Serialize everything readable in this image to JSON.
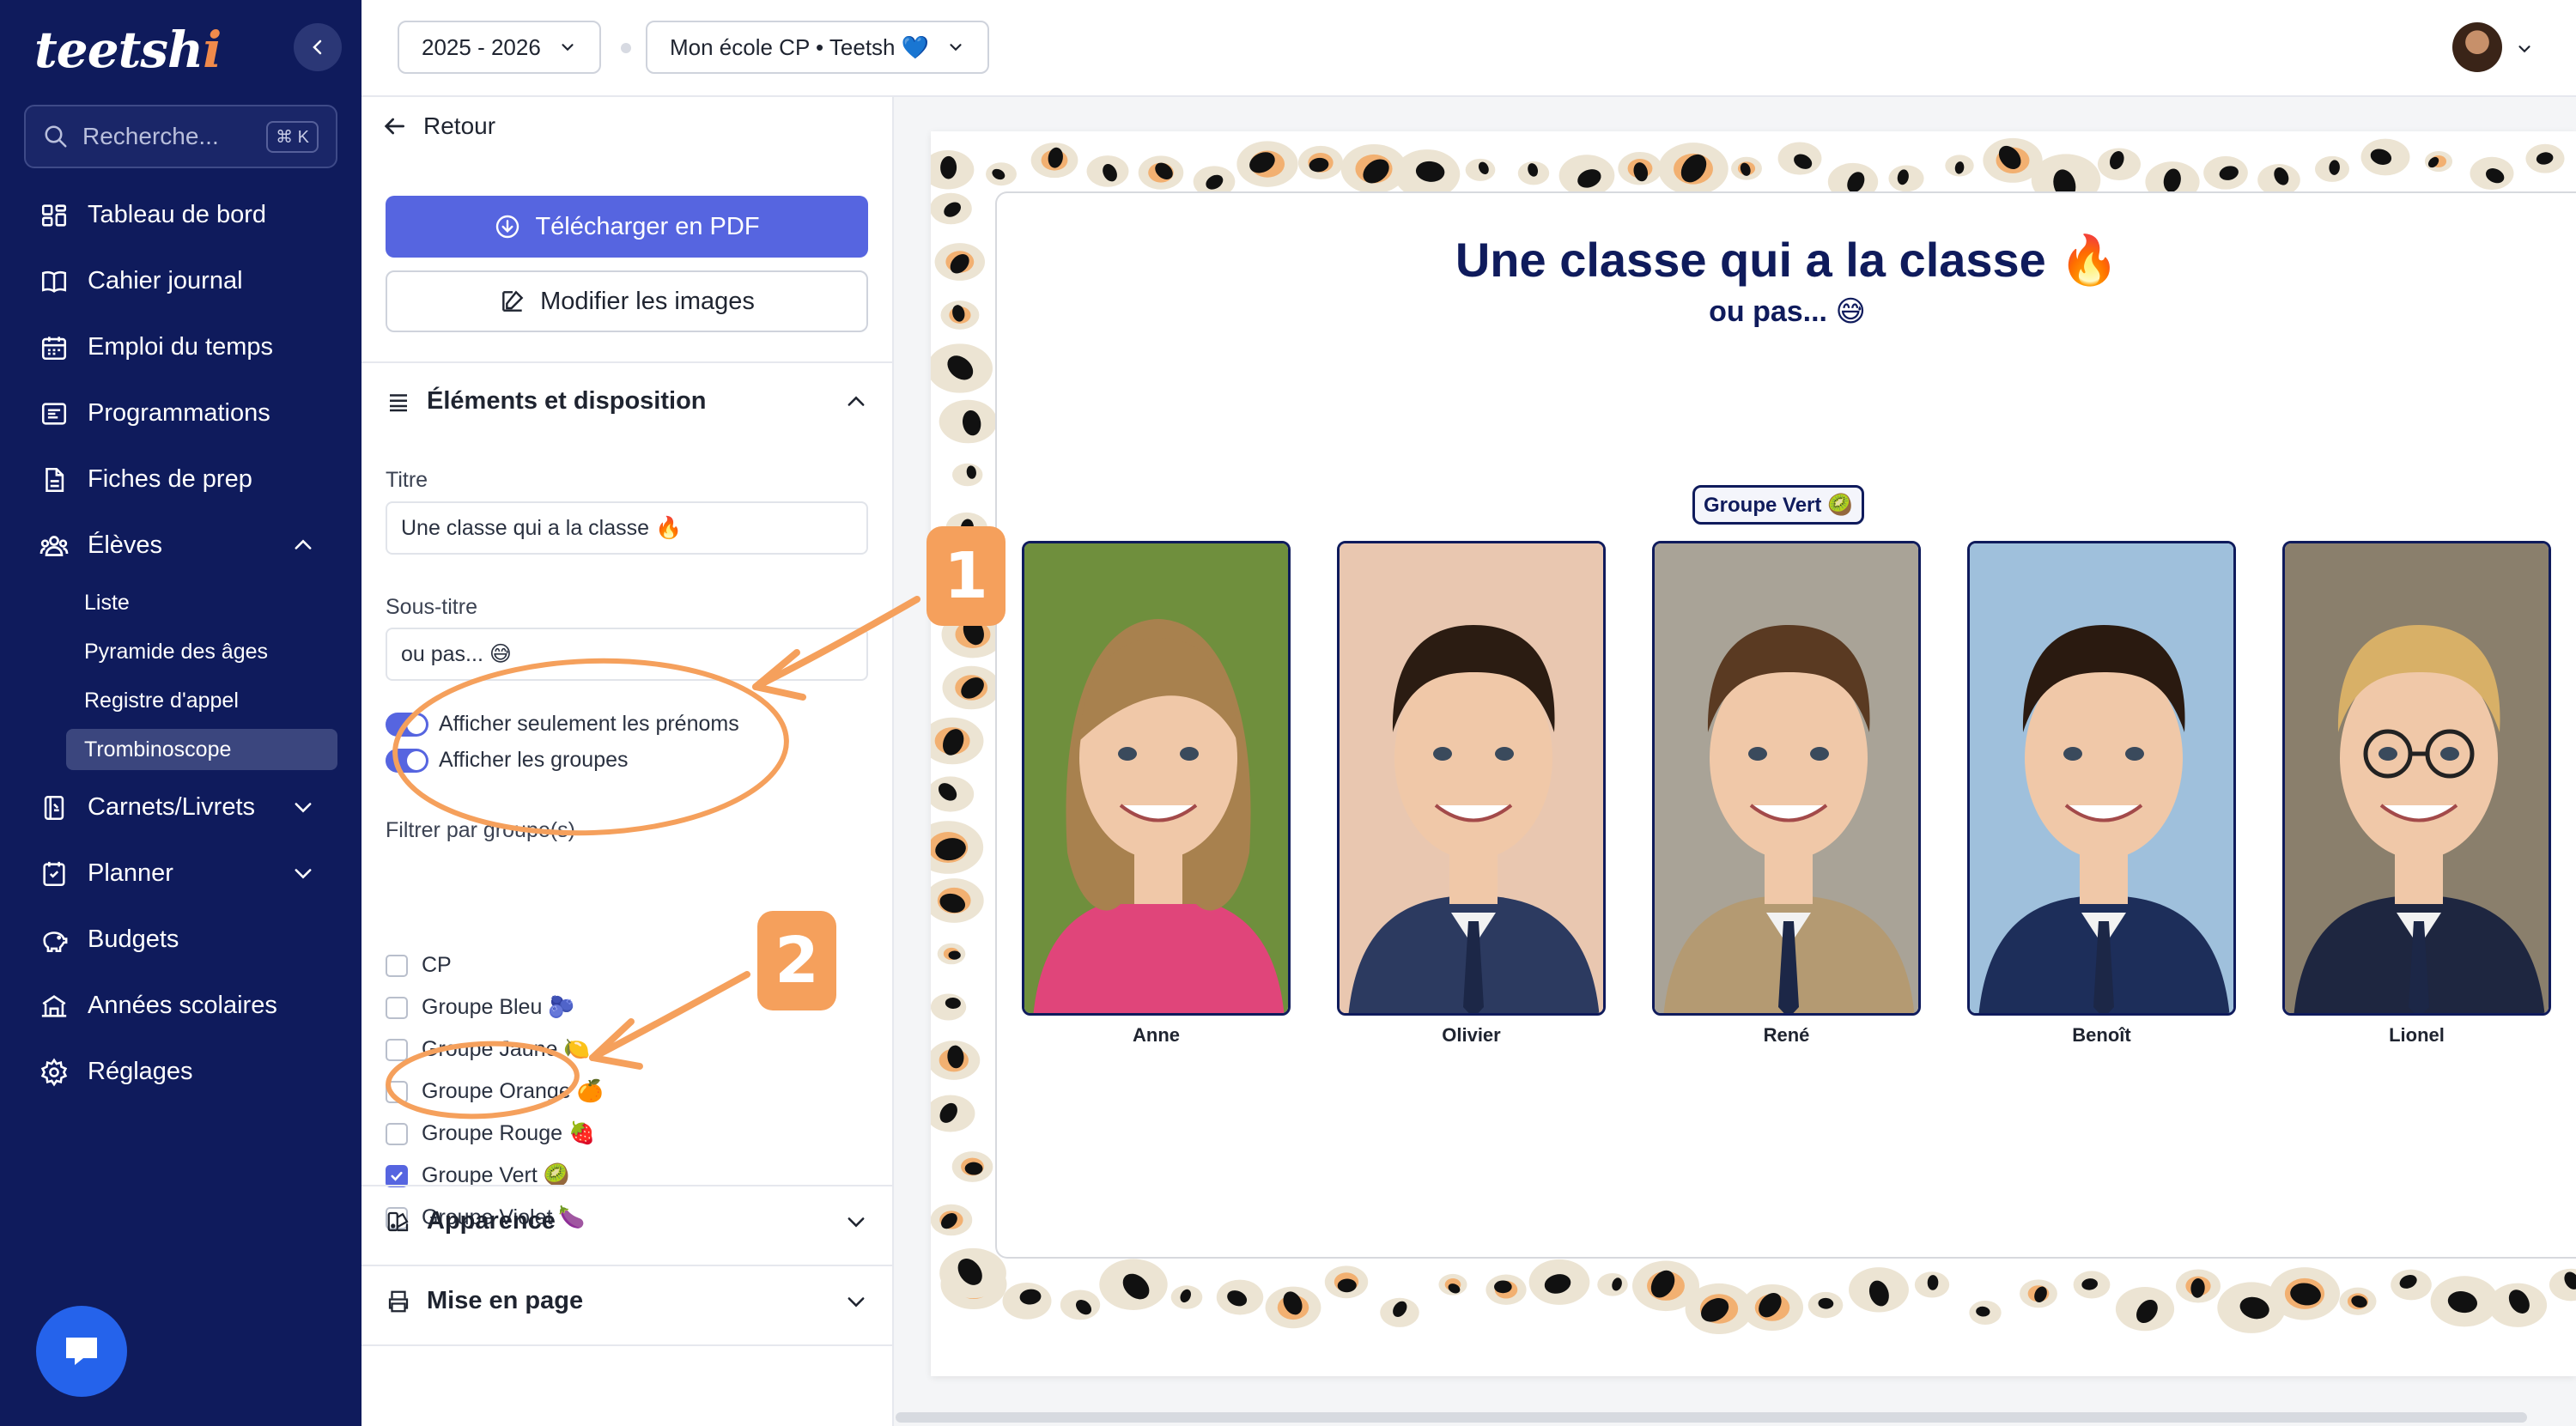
{
  "app": {
    "logo": "teetsh",
    "logo_suffix": "i"
  },
  "sidebar": {
    "search_placeholder": "Recherche...",
    "search_shortcut": "⌘ K",
    "items": [
      {
        "label": "Tableau de bord",
        "icon": "dashboard-icon"
      },
      {
        "label": "Cahier journal",
        "icon": "book-icon"
      },
      {
        "label": "Emploi du temps",
        "icon": "calendar-icon"
      },
      {
        "label": "Programmations",
        "icon": "list-icon"
      },
      {
        "label": "Fiches de prep",
        "icon": "file-icon"
      },
      {
        "label": "Élèves",
        "icon": "users-icon",
        "expanded": true
      },
      {
        "label": "Carnets/Livrets",
        "icon": "notebook-icon"
      },
      {
        "label": "Planner",
        "icon": "planner-icon"
      },
      {
        "label": "Budgets",
        "icon": "piggy-bank-icon"
      },
      {
        "label": "Années scolaires",
        "icon": "school-icon"
      },
      {
        "label": "Réglages",
        "icon": "gear-icon"
      }
    ],
    "eleves_sub": [
      "Liste",
      "Pyramide des âges",
      "Registre d'appel",
      "Trombinoscope"
    ],
    "active_sub": "Trombinoscope"
  },
  "topbar": {
    "year_select": "2025 - 2026",
    "school_select": "Mon école CP • Teetsh 💙"
  },
  "panel": {
    "back_label": "Retour",
    "download_pdf": "Télécharger en PDF",
    "edit_images": "Modifier les images",
    "section_elements": "Éléments et disposition",
    "title_label": "Titre",
    "title_value": "Une classe qui a la classe 🔥",
    "subtitle_label": "Sous-titre",
    "subtitle_value": "ou pas... 😅",
    "toggle_firstnames": "Afficher seulement les prénoms",
    "toggle_groups": "Afficher les groupes",
    "filter_label": "Filtrer par groupe(s)",
    "groups": [
      {
        "label": "CP",
        "checked": false
      },
      {
        "label": "Groupe Bleu 🫐",
        "checked": false
      },
      {
        "label": "Groupe Jaune 🍋",
        "checked": false
      },
      {
        "label": "Groupe Orange 🍊",
        "checked": false
      },
      {
        "label": "Groupe Rouge 🍓",
        "checked": false
      },
      {
        "label": "Groupe Vert 🥝",
        "checked": true
      },
      {
        "label": "Groupe Violet 🍆",
        "checked": false
      }
    ],
    "section_appearance": "Apparence",
    "section_layout": "Mise en page"
  },
  "annotations": {
    "badge_1": "1",
    "badge_2": "2",
    "color": "#f5a05c"
  },
  "preview": {
    "title": "Une classe qui a la classe 🔥",
    "subtitle": "ou pas... 😅",
    "group_label": "Groupe Vert 🥝",
    "students": [
      "Anne",
      "Olivier",
      "René",
      "Benoît",
      "Lionel"
    ]
  },
  "colors": {
    "sidebar": "#0f1b5c",
    "primary": "#5665e0",
    "accent": "#f5a05c"
  }
}
